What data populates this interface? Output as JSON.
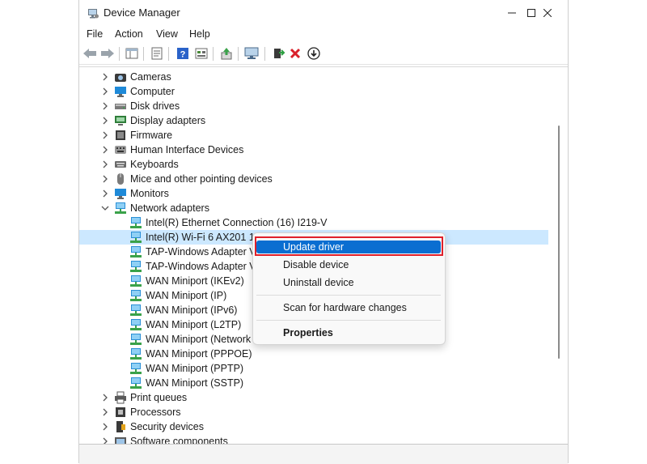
{
  "window": {
    "title": "Device Manager"
  },
  "menu": [
    "File",
    "Action",
    "View",
    "Help"
  ],
  "toolbar": {
    "icons": [
      "back-arrow-icon",
      "forward-arrow-icon",
      "show-hide-icon",
      "properties-icon",
      "help-icon",
      "view-icon",
      "update-driver-icon",
      "scan-hardware-icon",
      "enable-device-icon",
      "uninstall-icon",
      "download-icon"
    ]
  },
  "tree": {
    "top": [
      {
        "label": "Cameras",
        "icon": "camera-icon",
        "expanded": false
      },
      {
        "label": "Computer",
        "icon": "computer-icon",
        "expanded": false
      },
      {
        "label": "Disk drives",
        "icon": "disk-icon",
        "expanded": false
      },
      {
        "label": "Display adapters",
        "icon": "display-icon",
        "expanded": false
      },
      {
        "label": "Firmware",
        "icon": "firmware-icon",
        "expanded": false
      },
      {
        "label": "Human Interface Devices",
        "icon": "hid-icon",
        "expanded": false
      },
      {
        "label": "Keyboards",
        "icon": "keyboard-icon",
        "expanded": false
      },
      {
        "label": "Mice and other pointing devices",
        "icon": "mouse-icon",
        "expanded": false
      },
      {
        "label": "Monitors",
        "icon": "monitor-icon",
        "expanded": false
      },
      {
        "label": "Network adapters",
        "icon": "network-icon",
        "expanded": true
      }
    ],
    "network_children": [
      "Intel(R) Ethernet Connection (16) I219-V",
      "Intel(R) Wi-Fi 6 AX201 160MHz",
      "TAP-Windows Adapter V9",
      "TAP-Windows Adapter V9",
      "WAN Miniport (IKEv2)",
      "WAN Miniport (IP)",
      "WAN Miniport (IPv6)",
      "WAN Miniport (L2TP)",
      "WAN Miniport (Network",
      "WAN Miniport (PPPOE)",
      "WAN Miniport (PPTP)",
      "WAN Miniport (SSTP)"
    ],
    "bottom": [
      {
        "label": "Print queues",
        "icon": "printer-icon"
      },
      {
        "label": "Processors",
        "icon": "processor-icon"
      },
      {
        "label": "Security devices",
        "icon": "security-icon"
      },
      {
        "label": "Software components",
        "icon": "software-icon"
      }
    ]
  },
  "context_menu": {
    "items": [
      "Update driver",
      "Disable device",
      "Uninstall device",
      "Scan for hardware changes",
      "Properties"
    ],
    "highlighted": "Update driver"
  },
  "colors": {
    "accent": "#0a6ed1",
    "selection": "#cce8ff",
    "annotation": "#e0202a"
  }
}
